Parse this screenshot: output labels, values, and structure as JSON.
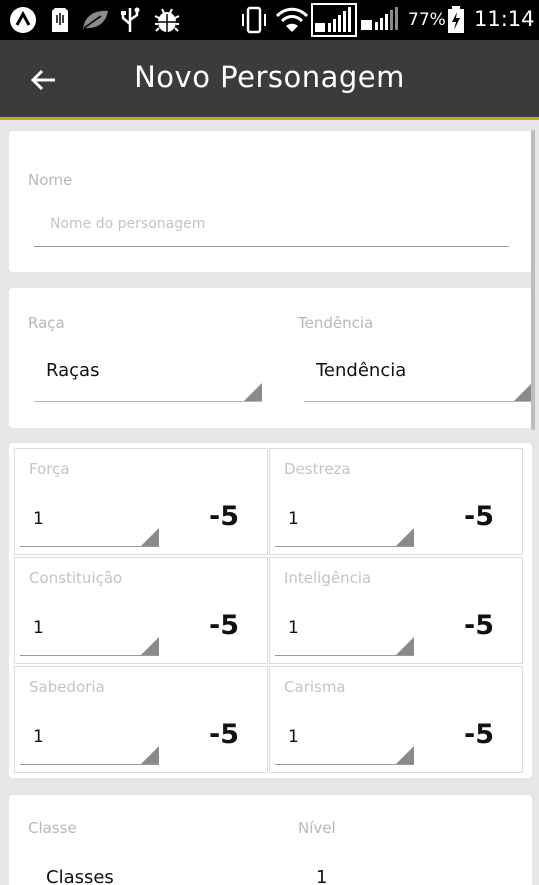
{
  "status_bar": {
    "battery_percent": "77%",
    "time": "11:14",
    "icons": [
      "app-icon",
      "sd-card-icon",
      "leaf-icon",
      "usb-icon",
      "android-debug-icon",
      "vibrate-icon",
      "wifi-icon",
      "signal-1-icon",
      "signal-2-icon",
      "battery-charging-icon"
    ]
  },
  "app_bar": {
    "title": "Novo Personagem",
    "back_icon": "arrow-back-icon"
  },
  "name_card": {
    "label": "Nome",
    "placeholder": "Nome do personagem",
    "value": ""
  },
  "race_card": {
    "race_label": "Raça",
    "race_value": "Raças",
    "alignment_label": "Tendência",
    "alignment_value": "Tendência"
  },
  "attributes": [
    {
      "name": "Força",
      "value": "1",
      "modifier": "-5"
    },
    {
      "name": "Destreza",
      "value": "1",
      "modifier": "-5"
    },
    {
      "name": "Constituição",
      "value": "1",
      "modifier": "-5"
    },
    {
      "name": "Inteligência",
      "value": "1",
      "modifier": "-5"
    },
    {
      "name": "Sabedoria",
      "value": "1",
      "modifier": "-5"
    },
    {
      "name": "Carisma",
      "value": "1",
      "modifier": "-5"
    }
  ],
  "class_card": {
    "class_label": "Classe",
    "class_value": "Classes",
    "level_label": "Nível",
    "level_value": "1"
  },
  "colors": {
    "status_bar": "#000000",
    "app_bar": "#3b3b3b",
    "accent": "#c9a227",
    "background": "#e6e6e6"
  }
}
